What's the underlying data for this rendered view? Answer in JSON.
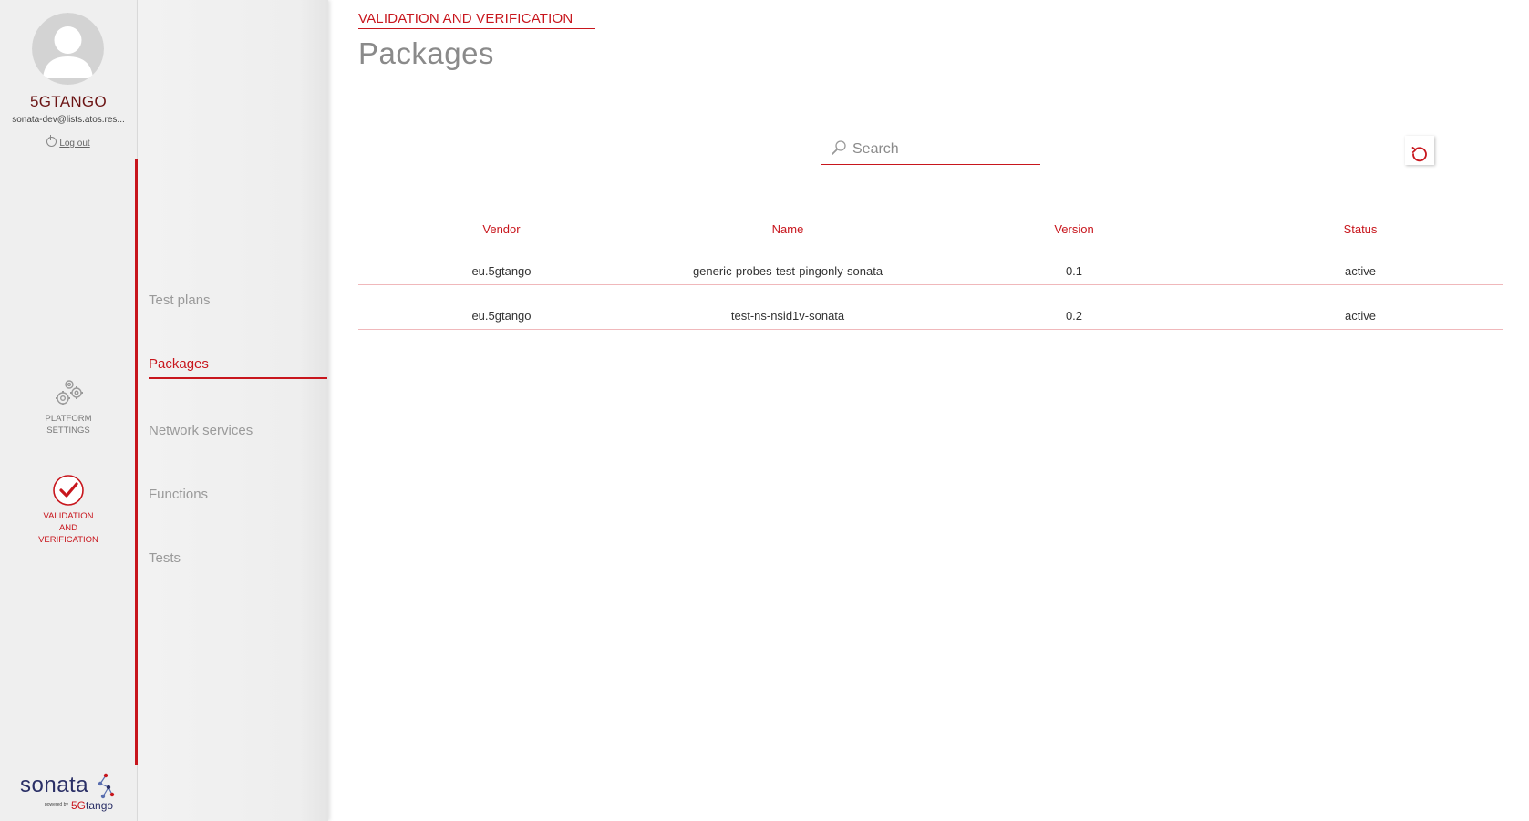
{
  "user": {
    "name": "5GTANGO",
    "email": "sonata-dev@lists.atos.res...",
    "logout_label": "Log out"
  },
  "rail": {
    "items": [
      {
        "label": "PLATFORM\nSETTINGS",
        "icon": "gears-icon",
        "active": false
      },
      {
        "label": "VALIDATION\nAND\nVERIFICATION",
        "icon": "checkmark-circle-icon",
        "active": true
      }
    ]
  },
  "brand": {
    "word": "sonata",
    "powered_by": "powered by",
    "product_prefix": "5G",
    "product_suffix": "tango"
  },
  "subnav": {
    "items": [
      {
        "label": "Test plans",
        "active": false
      },
      {
        "label": "Packages",
        "active": true
      },
      {
        "label": "Network services",
        "active": false
      },
      {
        "label": "Functions",
        "active": false
      },
      {
        "label": "Tests",
        "active": false
      }
    ]
  },
  "header": {
    "section": "VALIDATION AND VERIFICATION",
    "title": "Packages"
  },
  "search": {
    "placeholder": "Search",
    "value": ""
  },
  "table": {
    "columns": [
      "Vendor",
      "Name",
      "Version",
      "Status"
    ],
    "rows": [
      [
        "eu.5gtango",
        "generic-probes-test-pingonly-sonata",
        "0.1",
        "active"
      ],
      [
        "eu.5gtango",
        "test-ns-nsid1v-sonata",
        "0.2",
        "active"
      ]
    ]
  },
  "colors": {
    "accent": "#c8161d",
    "muted_text": "#8a8a8a",
    "rail_bg": "#efefef"
  }
}
